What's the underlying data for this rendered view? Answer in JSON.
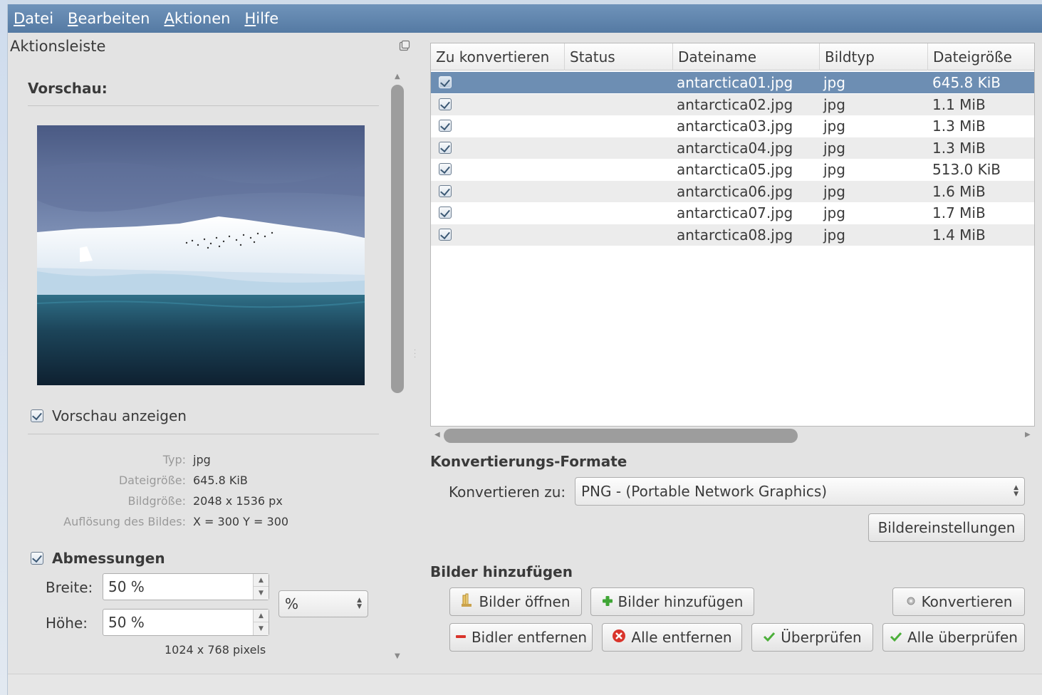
{
  "menu": {
    "items": [
      {
        "label_ul": "D",
        "label_rest": "atei"
      },
      {
        "label_ul": "B",
        "label_rest": "earbeiten"
      },
      {
        "label_ul": "A",
        "label_rest": "ktionen"
      },
      {
        "label_ul": "H",
        "label_rest": "ilfe"
      }
    ]
  },
  "sidebar": {
    "title": "Aktionsleiste",
    "preview_heading": "Vorschau:",
    "show_preview_label": "Vorschau anzeigen",
    "show_preview_checked": true,
    "info": {
      "type_key": "Typ:",
      "type_val": "jpg",
      "size_key": "Dateigröße:",
      "size_val": "645.8 KiB",
      "dims_key": "Bildgröße:",
      "dims_val": "2048 x 1536 px",
      "res_key": "Auflösung des Bildes:",
      "res_val": "X = 300 Y = 300"
    },
    "dimensions_heading": "Abmessungen",
    "dimensions_checked": true,
    "width_label": "Breite:",
    "width_value": "50 %",
    "height_label": "Höhe:",
    "height_value": "50 %",
    "unit_value": "%",
    "pixels_text": "1024 x 768 pixels"
  },
  "table": {
    "columns": [
      "Zu konvertieren",
      "Status",
      "Dateiname",
      "Bildtyp",
      "Dateigröße"
    ],
    "rows": [
      {
        "checked": true,
        "status": "",
        "name": "antarctica01.jpg",
        "type": "jpg",
        "size": "645.8 KiB"
      },
      {
        "checked": true,
        "status": "",
        "name": "antarctica02.jpg",
        "type": "jpg",
        "size": "1.1 MiB"
      },
      {
        "checked": true,
        "status": "",
        "name": "antarctica03.jpg",
        "type": "jpg",
        "size": "1.3 MiB"
      },
      {
        "checked": true,
        "status": "",
        "name": "antarctica04.jpg",
        "type": "jpg",
        "size": "1.3 MiB"
      },
      {
        "checked": true,
        "status": "",
        "name": "antarctica05.jpg",
        "type": "jpg",
        "size": "513.0 KiB"
      },
      {
        "checked": true,
        "status": "",
        "name": "antarctica06.jpg",
        "type": "jpg",
        "size": "1.6 MiB"
      },
      {
        "checked": true,
        "status": "",
        "name": "antarctica07.jpg",
        "type": "jpg",
        "size": "1.7 MiB"
      },
      {
        "checked": true,
        "status": "",
        "name": "antarctica08.jpg",
        "type": "jpg",
        "size": "1.4 MiB"
      }
    ],
    "selected_row": 0
  },
  "formats": {
    "heading": "Konvertierungs-Formate",
    "convert_to_label": "Konvertieren zu:",
    "selected_format": "PNG - (Portable Network Graphics)",
    "settings_button": "Bildereinstellungen"
  },
  "add_images": {
    "heading": "Bilder hinzufügen",
    "open_button": "Bilder öffnen",
    "add_button": "Bilder hinzufügen",
    "convert_button": "Konvertieren",
    "remove_button": "Bidler entfernen",
    "remove_all_button": "Alle entfernen",
    "check_button": "Überprüfen",
    "check_all_button": "Alle überprüfen"
  },
  "colors": {
    "menubar": "#5f84ad",
    "selection": "#6d8eb3",
    "remove_red": "#d9342b",
    "add_green": "#3fa535",
    "check_green": "#4caf3a"
  }
}
